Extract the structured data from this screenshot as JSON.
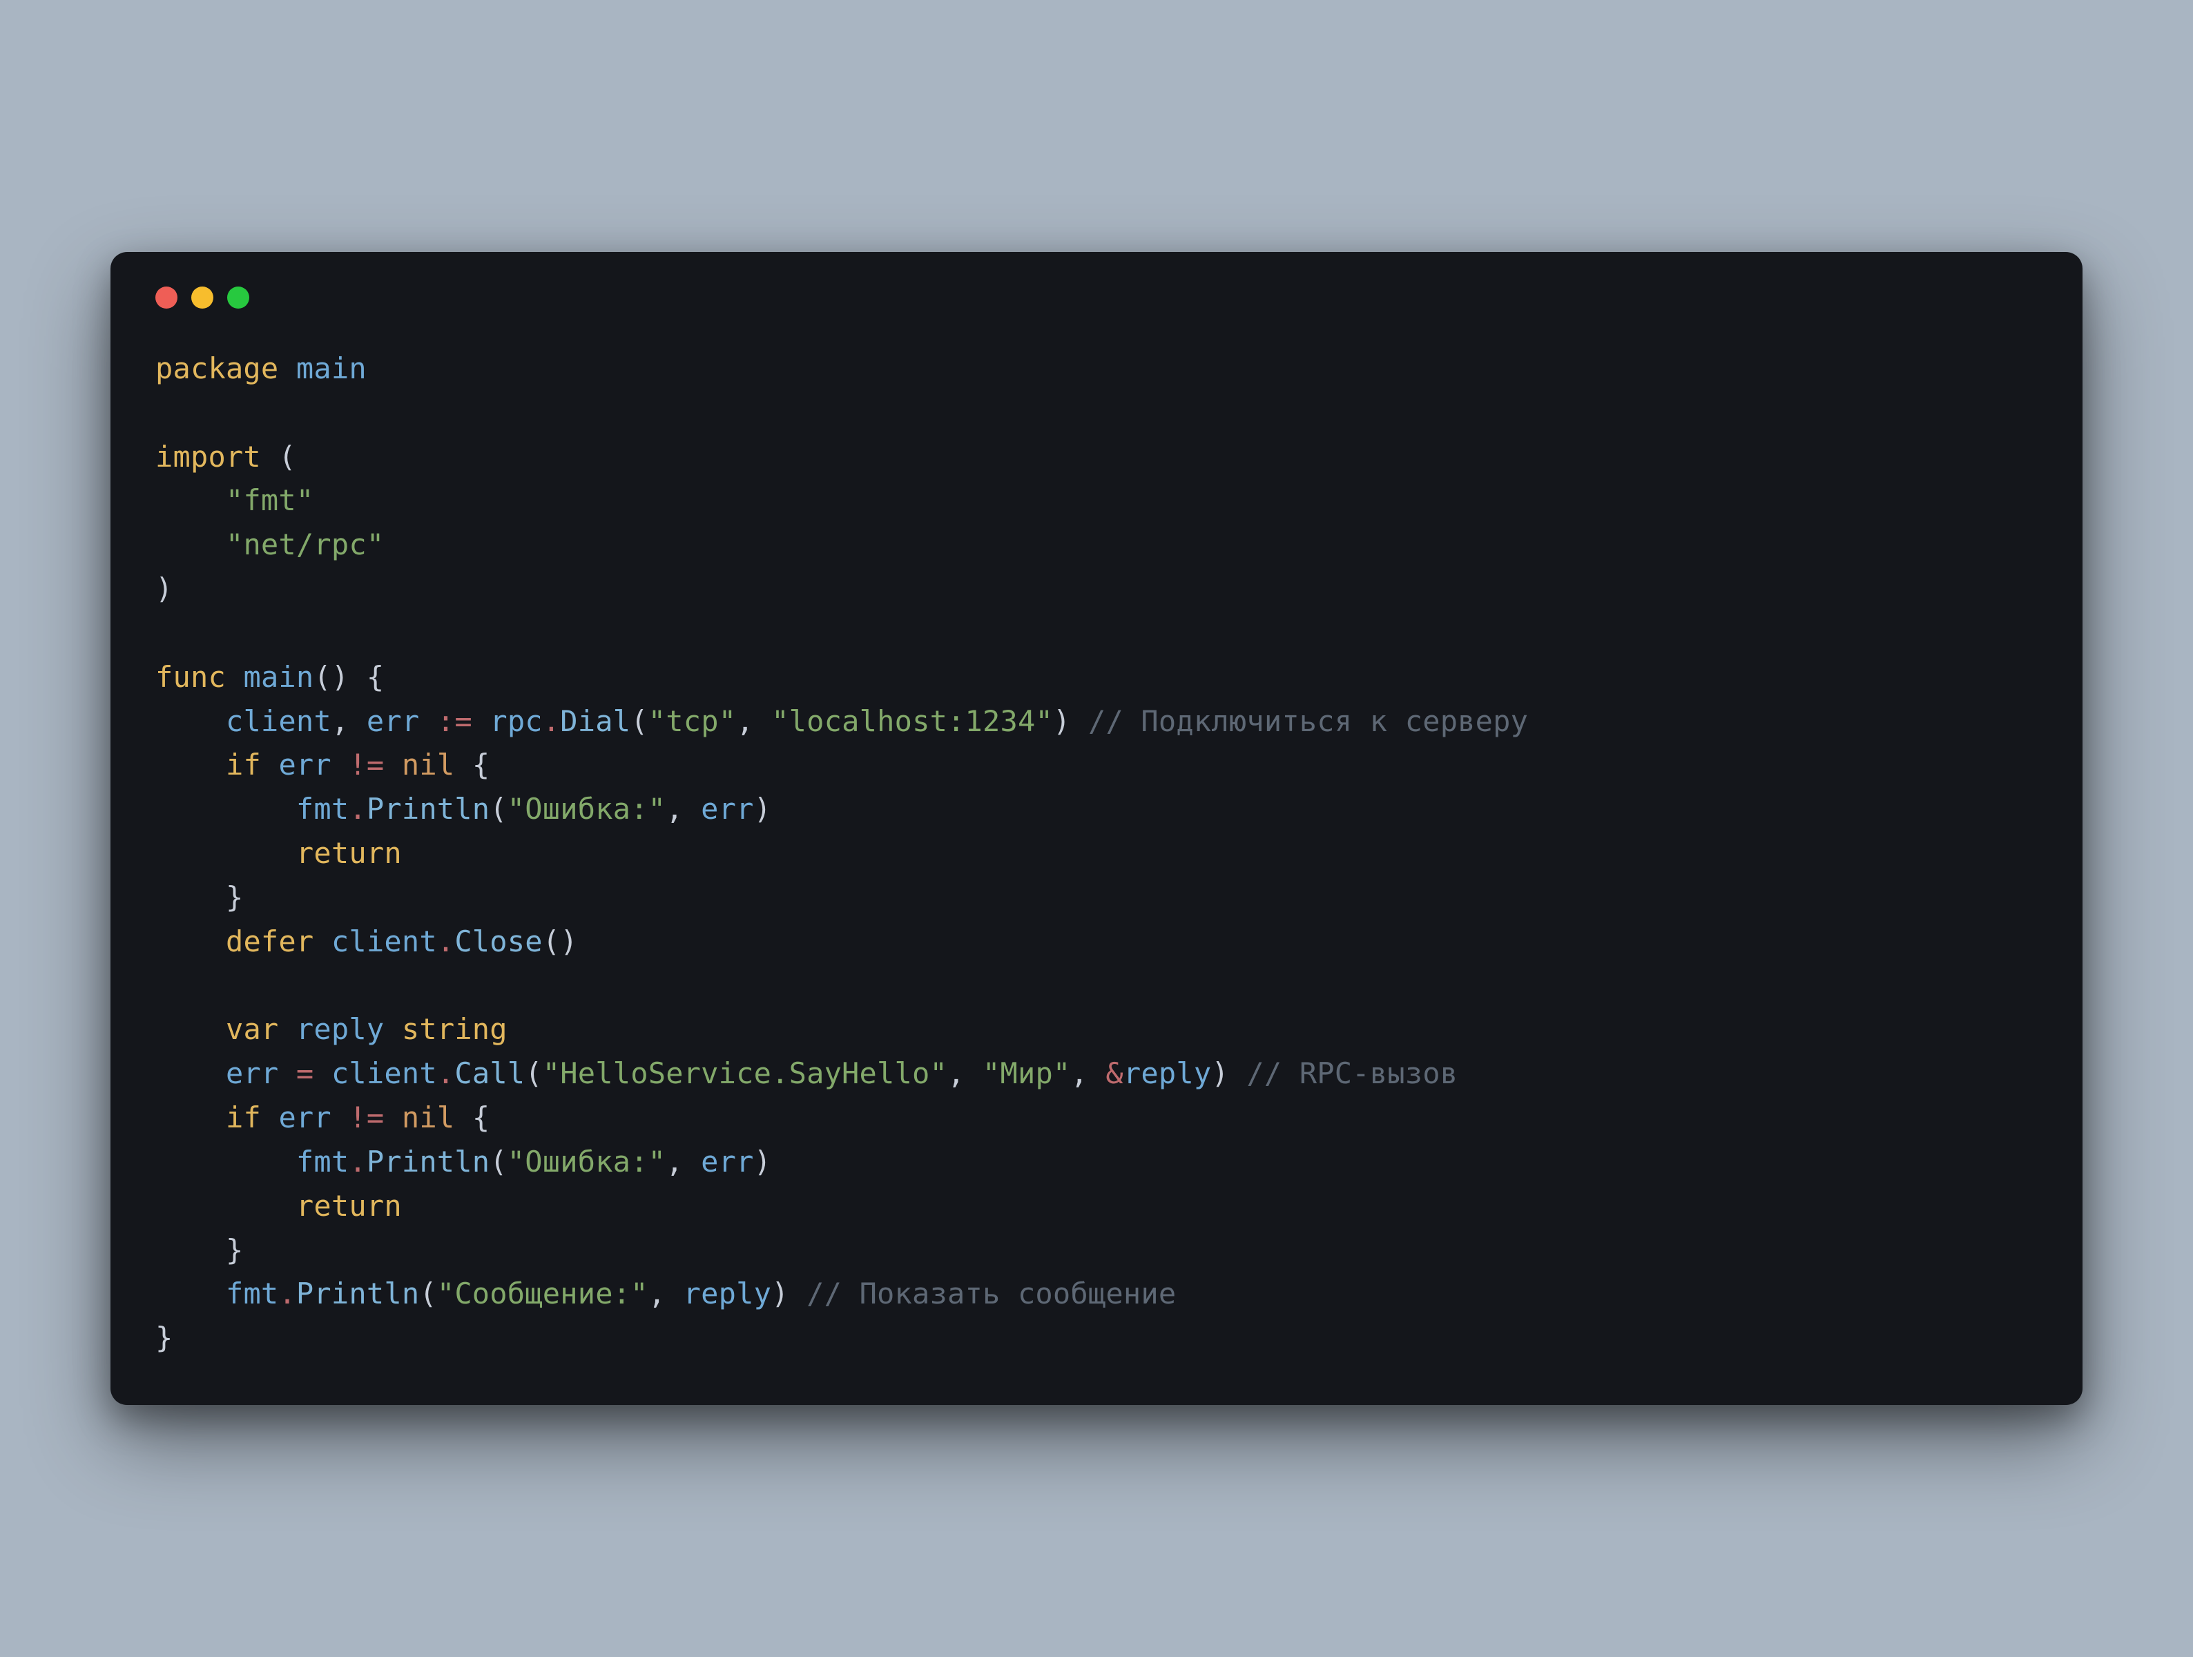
{
  "code": {
    "l1": {
      "kw_package": "package",
      "id_main": "main"
    },
    "l3": {
      "kw_import": "import",
      "p_open": "("
    },
    "l4": {
      "str_fmt": "\"fmt\""
    },
    "l5": {
      "str_netrpc": "\"net/rpc\""
    },
    "l6": {
      "p_close": ")"
    },
    "l8": {
      "kw_func": "func",
      "id_main": "main",
      "parens": "()",
      "brace": "{"
    },
    "l9": {
      "id_client": "client",
      "comma1": ",",
      "id_err": "err",
      "op_decl": ":=",
      "id_rpc": "rpc",
      "dot": ".",
      "fn_dial": "Dial",
      "p_open": "(",
      "str_tcp": "\"tcp\"",
      "comma2": ",",
      "str_host": "\"localhost:1234\"",
      "p_close": ")",
      "cmt": "// Подключиться к серверу"
    },
    "l10": {
      "kw_if": "if",
      "id_err": "err",
      "op_ne": "!=",
      "nil": "nil",
      "brace": "{"
    },
    "l11": {
      "id_fmt": "fmt",
      "dot": ".",
      "fn_println": "Println",
      "p_open": "(",
      "str": "\"Ошибка:\"",
      "comma": ",",
      "id_err": "err",
      "p_close": ")"
    },
    "l12": {
      "kw_return": "return"
    },
    "l13": {
      "brace": "}"
    },
    "l14": {
      "kw_defer": "defer",
      "id_client": "client",
      "dot": ".",
      "fn_close": "Close",
      "parens": "()"
    },
    "l16": {
      "kw_var": "var",
      "id_reply": "reply",
      "typ_string": "string"
    },
    "l17": {
      "id_err": "err",
      "op_eq": "=",
      "id_client": "client",
      "dot": ".",
      "fn_call": "Call",
      "p_open": "(",
      "str_svc": "\"HelloService.SayHello\"",
      "comma1": ",",
      "str_arg": "\"Мир\"",
      "comma2": ",",
      "op_amp": "&",
      "id_reply": "reply",
      "p_close": ")",
      "cmt": "// RPC-вызов"
    },
    "l18": {
      "kw_if": "if",
      "id_err": "err",
      "op_ne": "!=",
      "nil": "nil",
      "brace": "{"
    },
    "l19": {
      "id_fmt": "fmt",
      "dot": ".",
      "fn_println": "Println",
      "p_open": "(",
      "str": "\"Ошибка:\"",
      "comma": ",",
      "id_err": "err",
      "p_close": ")"
    },
    "l20": {
      "kw_return": "return"
    },
    "l21": {
      "brace": "}"
    },
    "l22": {
      "id_fmt": "fmt",
      "dot": ".",
      "fn_println": "Println",
      "p_open": "(",
      "str": "\"Сообщение:\"",
      "comma": ",",
      "id_reply": "reply",
      "p_close": ")",
      "cmt": "// Показать сообщение"
    },
    "l23": {
      "brace": "}"
    }
  }
}
